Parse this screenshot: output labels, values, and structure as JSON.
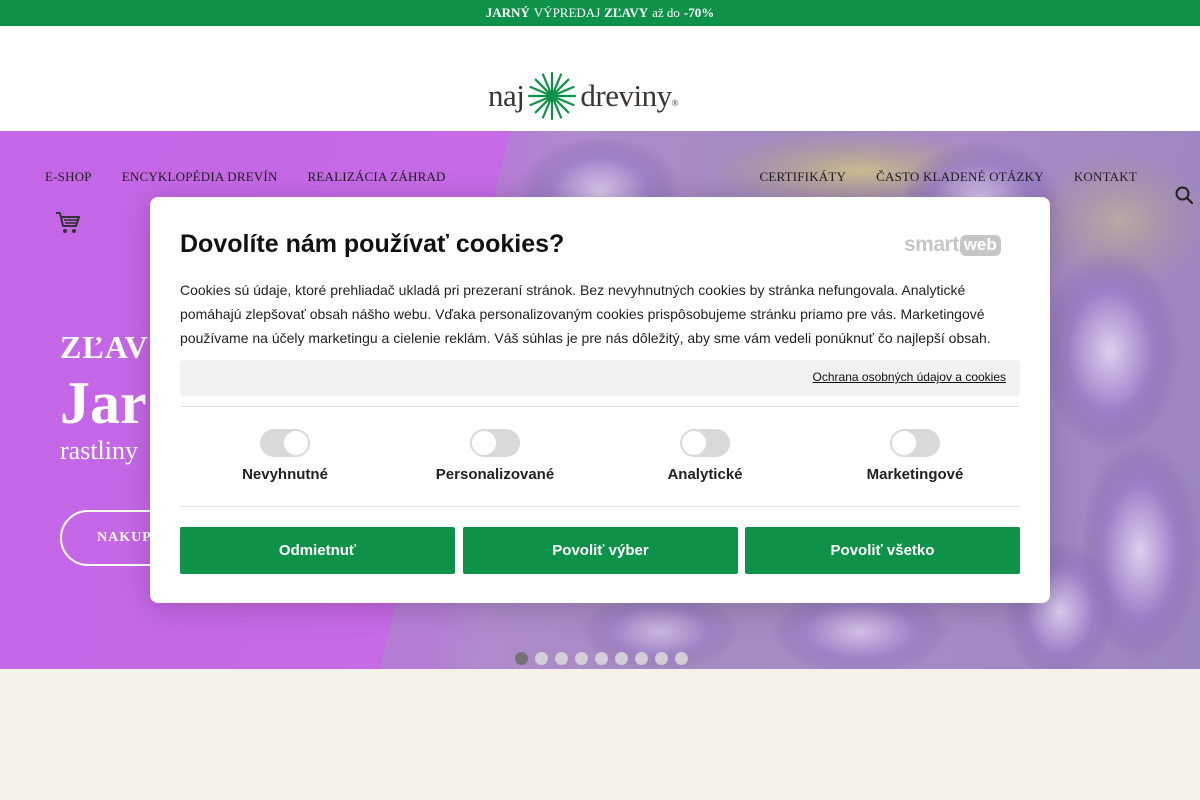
{
  "promo": {
    "part1": "JARNÝ",
    "part2": "VÝPREDAJ",
    "part3": "ZĽAVY",
    "part4": "až do",
    "part5": "-70%"
  },
  "logo": {
    "left": "naj",
    "right": "dreviny",
    "reg": "®"
  },
  "nav": {
    "left": [
      "E-SHOP",
      "ENCYKLOPÉDIA DREVÍN",
      "REALIZÁCIA ZÁHRAD"
    ],
    "right": [
      "CERTIFIKÁTY",
      "ČASTO KLADENÉ OTÁZKY",
      "KONTAKT"
    ]
  },
  "hero": {
    "line1": "ZĽAV",
    "line2": "Jar",
    "line3": "rastliny",
    "button": "NAKUP"
  },
  "slider": {
    "count": 9,
    "active": 0
  },
  "cookie": {
    "title": "Dovolíte nám používať cookies?",
    "brand_smart": "smart",
    "brand_web": "web",
    "text": "Cookies sú údaje, ktoré prehliadač ukladá pri prezeraní stránok. Bez nevyhnutných cookies by stránka nefungovala. Analytické pomáhajú zlepšovať obsah nášho webu. Vďaka personalizovaným cookies prispôsobujeme stránku priamo pre vás. Marketingové používame na účely marketingu a cielenie reklám. Váš súhlas je pre nás dôležitý, aby sme vám vedeli ponúknuť čo najlepší obsah.",
    "policy_link": "Ochrana osobných údajov a cookies",
    "toggles": [
      {
        "label": "Nevyhnutné",
        "state": "on"
      },
      {
        "label": "Personalizované",
        "state": "off"
      },
      {
        "label": "Analytické",
        "state": "off"
      },
      {
        "label": "Marketingové",
        "state": "off"
      }
    ],
    "buttons": {
      "reject": "Odmietnuť",
      "allow_selection": "Povoliť výber",
      "allow_all": "Povoliť všetko"
    }
  },
  "colors": {
    "brand_green": "#0e9148",
    "hero_purple": "#c466e6"
  }
}
